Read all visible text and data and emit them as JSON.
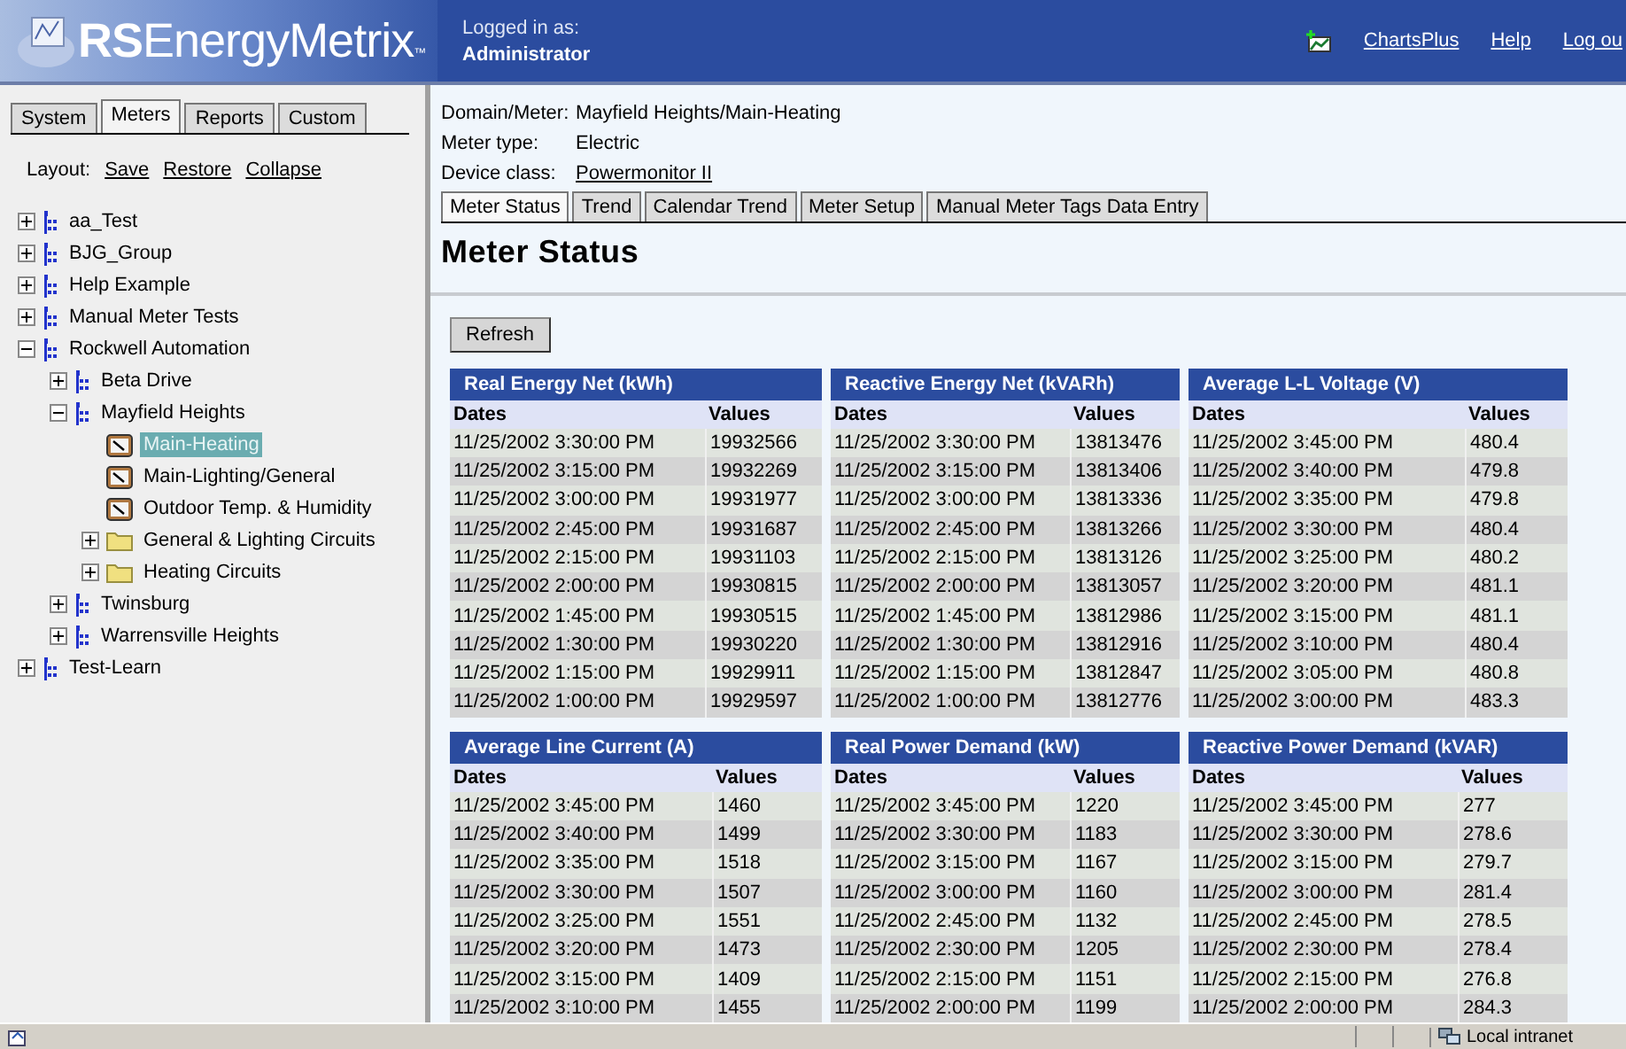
{
  "header": {
    "logo": "RSEnergyMetrix",
    "logo_tm": "™",
    "logged_in_label": "Logged in as:",
    "user": "Administrator",
    "links": [
      {
        "label": "ChartsPlus",
        "kind": "charts"
      },
      {
        "label": "Help",
        "kind": "plain"
      },
      {
        "label": "Log ou",
        "kind": "plain"
      }
    ]
  },
  "sidebar": {
    "tabs": [
      {
        "label": "System",
        "selected": false
      },
      {
        "label": "Meters",
        "selected": true
      },
      {
        "label": "Reports",
        "selected": false
      },
      {
        "label": "Custom",
        "selected": false
      }
    ],
    "layout_label": "Layout:",
    "layout_links": [
      "Save",
      "Restore",
      "Collapse"
    ],
    "tree": [
      {
        "label": "aa_Test",
        "kind": "group",
        "expanded": false,
        "selected": false
      },
      {
        "label": "BJG_Group",
        "kind": "group",
        "expanded": false,
        "selected": false
      },
      {
        "label": "Help Example",
        "kind": "group",
        "expanded": false,
        "selected": false
      },
      {
        "label": "Manual Meter Tests",
        "kind": "group",
        "expanded": false,
        "selected": false
      },
      {
        "label": "Rockwell Automation",
        "kind": "group",
        "expanded": true,
        "selected": false,
        "children": [
          {
            "label": "Beta Drive",
            "kind": "group",
            "expanded": false,
            "selected": false
          },
          {
            "label": "Mayfield Heights",
            "kind": "group",
            "expanded": true,
            "selected": false,
            "children": [
              {
                "label": "Main-Heating",
                "kind": "meter",
                "selected": true
              },
              {
                "label": "Main-Lighting/General",
                "kind": "meter",
                "selected": false
              },
              {
                "label": "Outdoor Temp. & Humidity",
                "kind": "meter",
                "selected": false
              },
              {
                "label": "General & Lighting Circuits",
                "kind": "folder",
                "expanded": false,
                "selected": false
              },
              {
                "label": "Heating Circuits",
                "kind": "folder",
                "expanded": false,
                "selected": false
              }
            ]
          },
          {
            "label": "Twinsburg",
            "kind": "group",
            "expanded": false,
            "selected": false
          },
          {
            "label": "Warrensville Heights",
            "kind": "group",
            "expanded": false,
            "selected": false
          }
        ]
      },
      {
        "label": "Test-Learn",
        "kind": "group",
        "expanded": false,
        "selected": false
      }
    ]
  },
  "info": [
    {
      "label": "Domain/Meter:",
      "value": "Mayfield Heights/Main-Heating",
      "link": false
    },
    {
      "label": "Meter type:",
      "value": "Electric",
      "link": false
    },
    {
      "label": "Device class:",
      "value": "Powermonitor II",
      "link": true
    }
  ],
  "tabs": [
    {
      "label": "Meter Status",
      "selected": true
    },
    {
      "label": "Trend",
      "selected": false
    },
    {
      "label": "Calendar Trend",
      "selected": false
    },
    {
      "label": "Meter Setup",
      "selected": false
    },
    {
      "label": "Manual Meter Tags Data Entry",
      "selected": false
    }
  ],
  "page_title": "Meter Status",
  "refresh_button": "Refresh",
  "tables": [
    {
      "title": "Real Energy Net (kWh)",
      "columns": [
        "Dates",
        "Values"
      ],
      "rows": [
        [
          "11/25/2002 3:30:00 PM",
          "19932566"
        ],
        [
          "11/25/2002 3:15:00 PM",
          "19932269"
        ],
        [
          "11/25/2002 3:00:00 PM",
          "19931977"
        ],
        [
          "11/25/2002 2:45:00 PM",
          "19931687"
        ],
        [
          "11/25/2002 2:15:00 PM",
          "19931103"
        ],
        [
          "11/25/2002 2:00:00 PM",
          "19930815"
        ],
        [
          "11/25/2002 1:45:00 PM",
          "19930515"
        ],
        [
          "11/25/2002 1:30:00 PM",
          "19930220"
        ],
        [
          "11/25/2002 1:15:00 PM",
          "19929911"
        ],
        [
          "11/25/2002 1:00:00 PM",
          "19929597"
        ]
      ]
    },
    {
      "title": "Reactive Energy Net (kVARh)",
      "columns": [
        "Dates",
        "Values"
      ],
      "rows": [
        [
          "11/25/2002 3:30:00 PM",
          "13813476"
        ],
        [
          "11/25/2002 3:15:00 PM",
          "13813406"
        ],
        [
          "11/25/2002 3:00:00 PM",
          "13813336"
        ],
        [
          "11/25/2002 2:45:00 PM",
          "13813266"
        ],
        [
          "11/25/2002 2:15:00 PM",
          "13813126"
        ],
        [
          "11/25/2002 2:00:00 PM",
          "13813057"
        ],
        [
          "11/25/2002 1:45:00 PM",
          "13812986"
        ],
        [
          "11/25/2002 1:30:00 PM",
          "13812916"
        ],
        [
          "11/25/2002 1:15:00 PM",
          "13812847"
        ],
        [
          "11/25/2002 1:00:00 PM",
          "13812776"
        ]
      ]
    },
    {
      "title": "Average L-L Voltage (V)",
      "columns": [
        "Dates",
        "Values"
      ],
      "rows": [
        [
          "11/25/2002 3:45:00 PM",
          "480.4"
        ],
        [
          "11/25/2002 3:40:00 PM",
          "479.8"
        ],
        [
          "11/25/2002 3:35:00 PM",
          "479.8"
        ],
        [
          "11/25/2002 3:30:00 PM",
          "480.4"
        ],
        [
          "11/25/2002 3:25:00 PM",
          "480.2"
        ],
        [
          "11/25/2002 3:20:00 PM",
          "481.1"
        ],
        [
          "11/25/2002 3:15:00 PM",
          "481.1"
        ],
        [
          "11/25/2002 3:10:00 PM",
          "480.4"
        ],
        [
          "11/25/2002 3:05:00 PM",
          "480.8"
        ],
        [
          "11/25/2002 3:00:00 PM",
          "483.3"
        ]
      ]
    },
    {
      "title": "Average Line Current (A)",
      "columns": [
        "Dates",
        "Values"
      ],
      "rows": [
        [
          "11/25/2002 3:45:00 PM",
          "1460"
        ],
        [
          "11/25/2002 3:40:00 PM",
          "1499"
        ],
        [
          "11/25/2002 3:35:00 PM",
          "1518"
        ],
        [
          "11/25/2002 3:30:00 PM",
          "1507"
        ],
        [
          "11/25/2002 3:25:00 PM",
          "1551"
        ],
        [
          "11/25/2002 3:20:00 PM",
          "1473"
        ],
        [
          "11/25/2002 3:15:00 PM",
          "1409"
        ],
        [
          "11/25/2002 3:10:00 PM",
          "1455"
        ]
      ]
    },
    {
      "title": "Real Power Demand (kW)",
      "columns": [
        "Dates",
        "Values"
      ],
      "rows": [
        [
          "11/25/2002 3:45:00 PM",
          "1220"
        ],
        [
          "11/25/2002 3:30:00 PM",
          "1183"
        ],
        [
          "11/25/2002 3:15:00 PM",
          "1167"
        ],
        [
          "11/25/2002 3:00:00 PM",
          "1160"
        ],
        [
          "11/25/2002 2:45:00 PM",
          "1132"
        ],
        [
          "11/25/2002 2:30:00 PM",
          "1205"
        ],
        [
          "11/25/2002 2:15:00 PM",
          "1151"
        ],
        [
          "11/25/2002 2:00:00 PM",
          "1199"
        ]
      ]
    },
    {
      "title": "Reactive Power Demand (kVAR)",
      "columns": [
        "Dates",
        "Values"
      ],
      "rows": [
        [
          "11/25/2002 3:45:00 PM",
          "277"
        ],
        [
          "11/25/2002 3:30:00 PM",
          "278.6"
        ],
        [
          "11/25/2002 3:15:00 PM",
          "279.7"
        ],
        [
          "11/25/2002 3:00:00 PM",
          "281.4"
        ],
        [
          "11/25/2002 2:45:00 PM",
          "278.5"
        ],
        [
          "11/25/2002 2:30:00 PM",
          "278.4"
        ],
        [
          "11/25/2002 2:15:00 PM",
          "276.8"
        ],
        [
          "11/25/2002 2:00:00 PM",
          "284.3"
        ]
      ]
    }
  ],
  "status_bar": {
    "zone": "Local intranet"
  }
}
